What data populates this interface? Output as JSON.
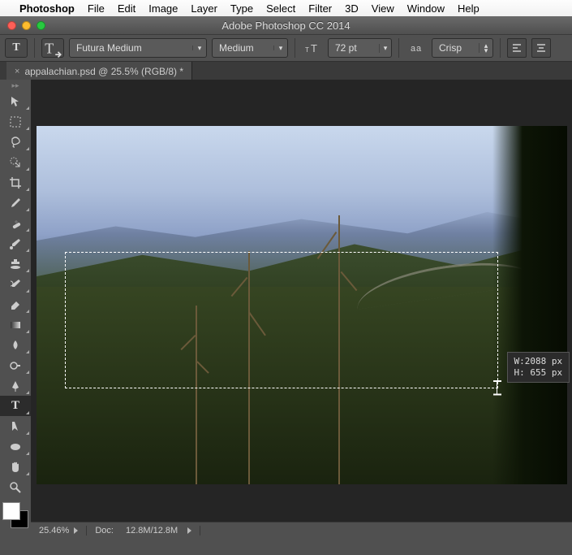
{
  "mac_menu": {
    "apple": "",
    "app": "Photoshop",
    "items": [
      "File",
      "Edit",
      "Image",
      "Layer",
      "Type",
      "Select",
      "Filter",
      "3D",
      "View",
      "Window",
      "Help"
    ]
  },
  "window": {
    "title": "Adobe Photoshop CC 2014"
  },
  "options_bar": {
    "tool_glyph": "T",
    "font_family": "Futura Medium",
    "font_style": "Medium",
    "font_size_value": "72 pt",
    "antialias_label": "Crisp"
  },
  "tab": {
    "label": "appalachian.psd @ 25.5% (RGB/8) *"
  },
  "tools": [
    {
      "name": "move-tool",
      "selected": false
    },
    {
      "name": "marquee-tool",
      "selected": false
    },
    {
      "name": "lasso-tool",
      "selected": false
    },
    {
      "name": "quick-select-tool",
      "selected": false
    },
    {
      "name": "crop-tool",
      "selected": false
    },
    {
      "name": "eyedropper-tool",
      "selected": false
    },
    {
      "name": "healing-brush-tool",
      "selected": false
    },
    {
      "name": "brush-tool",
      "selected": false
    },
    {
      "name": "clone-stamp-tool",
      "selected": false
    },
    {
      "name": "history-brush-tool",
      "selected": false
    },
    {
      "name": "eraser-tool",
      "selected": false
    },
    {
      "name": "gradient-tool",
      "selected": false
    },
    {
      "name": "blur-tool",
      "selected": false
    },
    {
      "name": "dodge-tool",
      "selected": false
    },
    {
      "name": "pen-tool",
      "selected": false
    },
    {
      "name": "type-tool",
      "selected": true
    },
    {
      "name": "path-select-tool",
      "selected": false
    },
    {
      "name": "shape-tool",
      "selected": false
    },
    {
      "name": "hand-tool",
      "selected": false
    },
    {
      "name": "zoom-tool",
      "selected": false
    }
  ],
  "swatches": {
    "fg": "#ffffff",
    "bg": "#000000"
  },
  "textbox_tip": {
    "w_label": "W:",
    "w_val": "2088 px",
    "h_label": "H:",
    "h_val": " 655 px"
  },
  "status": {
    "zoom": "25.46%",
    "doc_label": "Doc:",
    "doc_val": "12.8M/12.8M"
  }
}
